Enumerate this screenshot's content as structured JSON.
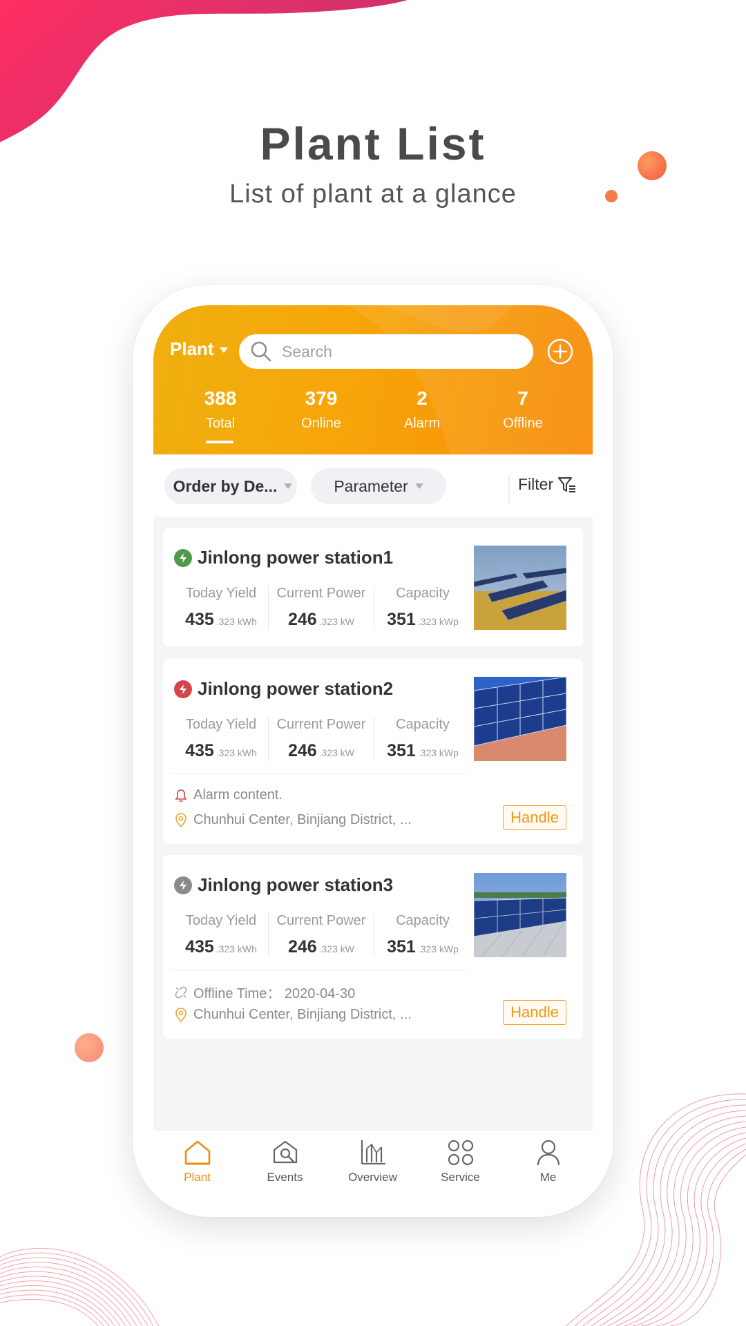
{
  "promo": {
    "title": "Plant List",
    "subtitle": "List of plant at a glance"
  },
  "header": {
    "plant_selector": "Plant",
    "search_placeholder": "Search",
    "stats": [
      {
        "value": "388",
        "label": "Total"
      },
      {
        "value": "379",
        "label": "Online"
      },
      {
        "value": "2",
        "label": "Alarm"
      },
      {
        "value": "7",
        "label": "Offline"
      }
    ]
  },
  "filters": {
    "order_label": "Order by De...",
    "parameter_label": "Parameter",
    "filter_label": "Filter"
  },
  "metric_labels": {
    "today_yield": "Today Yield",
    "current_power": "Current Power",
    "capacity": "Capacity"
  },
  "plants": [
    {
      "name": "Jinlong power station1",
      "status": "normal",
      "status_color": "#4e9a4a",
      "today_yield": "435",
      "today_yield_unit": ".323 kWh",
      "current_power": "246",
      "current_power_unit": ".323 kW",
      "capacity": "351",
      "capacity_unit": ".323 kWp"
    },
    {
      "name": "Jinlong power station2",
      "status": "alarm",
      "status_color": "#d4464a",
      "today_yield": "435",
      "today_yield_unit": ".323 kWh",
      "current_power": "246",
      "current_power_unit": ".323 kW",
      "capacity": "351",
      "capacity_unit": ".323 kWp",
      "alarm_text": "Alarm content.",
      "location": "Chunhui Center, Binjiang District, ...",
      "action": "Handle"
    },
    {
      "name": "Jinlong power station3",
      "status": "offline",
      "status_color": "#8a8a8a",
      "today_yield": "435",
      "today_yield_unit": ".323 kWh",
      "current_power": "246",
      "current_power_unit": ".323 kW",
      "capacity": "351",
      "capacity_unit": ".323 kWp",
      "offline_text": "Offline Time： 2020-04-30",
      "location": "Chunhui Center, Binjiang District, ...",
      "action": "Handle"
    }
  ],
  "tabbar": [
    {
      "label": "Plant",
      "icon": "home-icon",
      "active": true
    },
    {
      "label": "Events",
      "icon": "events-icon",
      "active": false
    },
    {
      "label": "Overview",
      "icon": "chart-icon",
      "active": false
    },
    {
      "label": "Service",
      "icon": "grid-icon",
      "active": false
    },
    {
      "label": "Me",
      "icon": "user-icon",
      "active": false
    }
  ],
  "colors": {
    "accent": "#f08a12",
    "header_start": "#efb00e",
    "header_end": "#f78a06"
  }
}
